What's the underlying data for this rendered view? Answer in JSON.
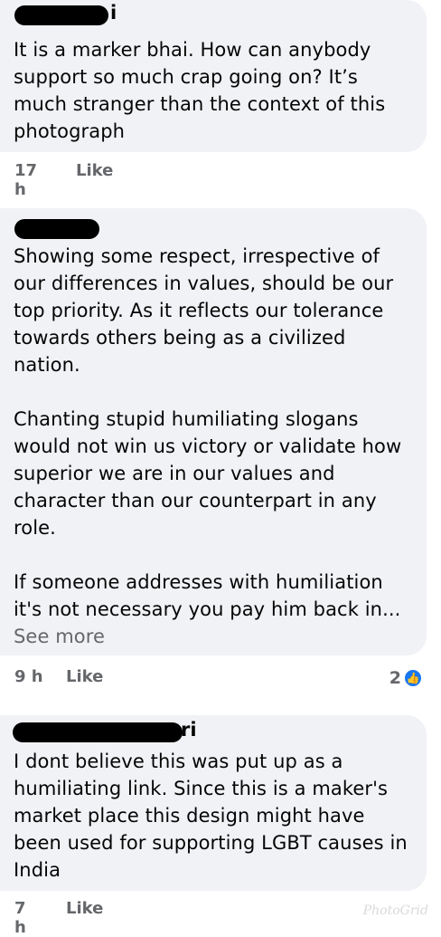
{
  "comments": [
    {
      "name_tail": "i",
      "text": "It is a marker bhai. How can anybody\nsupport so much crap going on? It’s\nmuch stranger than the context of this\nphotograph",
      "time": "17 h",
      "like_label": "Like"
    },
    {
      "name_tail": "",
      "text": "Showing some respect, irrespective of\nour differences in values, should be our\ntop priority. As it reflects our tolerance\ntowards others being as a civilized\nnation.\n\nChanting stupid humiliating slogans\nwould not win us victory or validate how\nsuperior we are in our values and\ncharacter than our counterpart in any\nrole.\n\nIf someone addresses with humiliation\nit's not necessary you pay him back in...",
      "see_more": "See more",
      "time": "9 h",
      "like_label": "Like",
      "reaction_count": "2",
      "reaction_icon": "thumbs-up-icon"
    },
    {
      "name_tail": "ri",
      "text": "I dont believe this was put up as a\nhumiliating link. Since this is a maker's\nmarket place this design might have\nbeen used for supporting LGBT causes in\nIndia",
      "time": "7 h",
      "like_label": "Like"
    }
  ],
  "watermark": "PhotoGrid",
  "colors": {
    "bubble": "#f0f2f5",
    "meta_text": "#65676b",
    "reaction_blue": "#1877f2"
  }
}
